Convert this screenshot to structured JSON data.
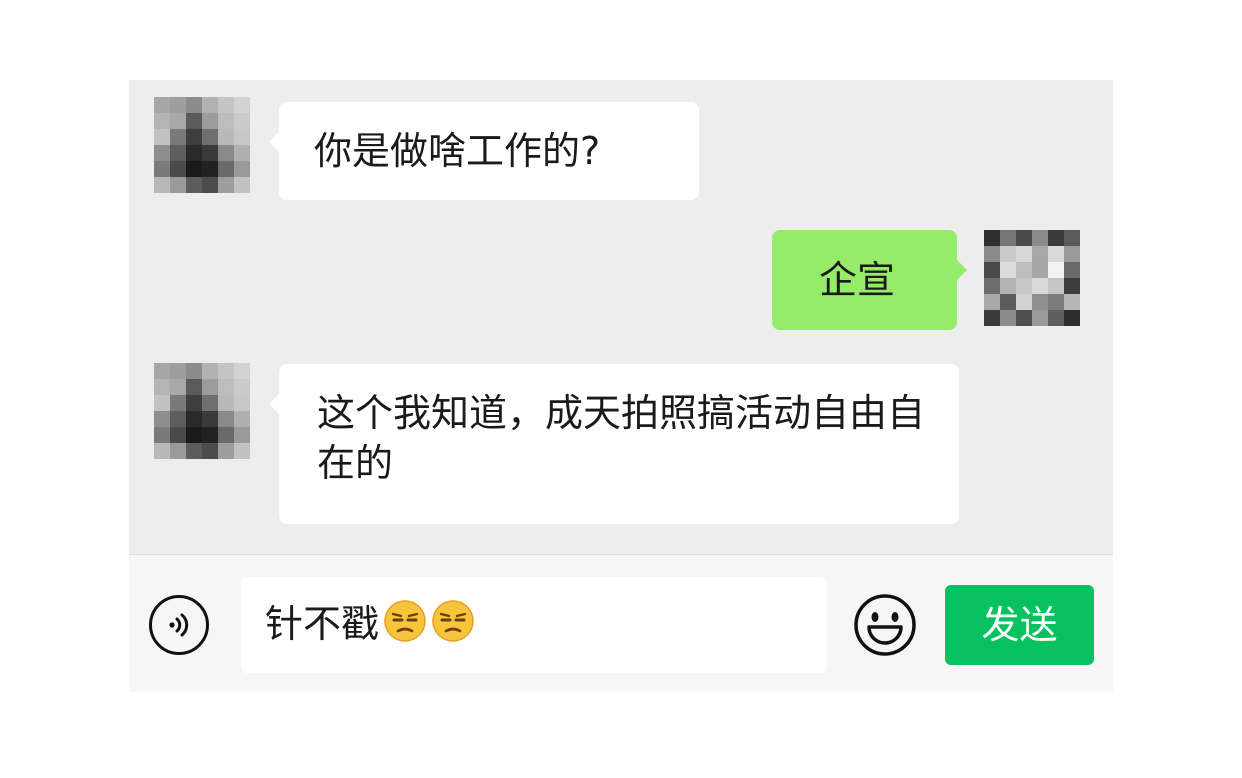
{
  "messages": [
    {
      "sender": "other",
      "text": "你是做啥工作的?"
    },
    {
      "sender": "me",
      "text": "企宣"
    },
    {
      "sender": "other",
      "text": "这个我知道，成天拍照搞活动自由自在的"
    }
  ],
  "input": {
    "value": "针不戳",
    "emoji_icons": [
      "unamused-face-icon",
      "unamused-face-icon"
    ]
  },
  "toolbar": {
    "voice_icon": "voice-icon",
    "emoji_icon": "emoji-icon",
    "send_label": "发送"
  },
  "colors": {
    "chat_background": "#ededed",
    "incoming_bubble": "#ffffff",
    "outgoing_bubble": "#95ec69",
    "send_button": "#07c160"
  }
}
